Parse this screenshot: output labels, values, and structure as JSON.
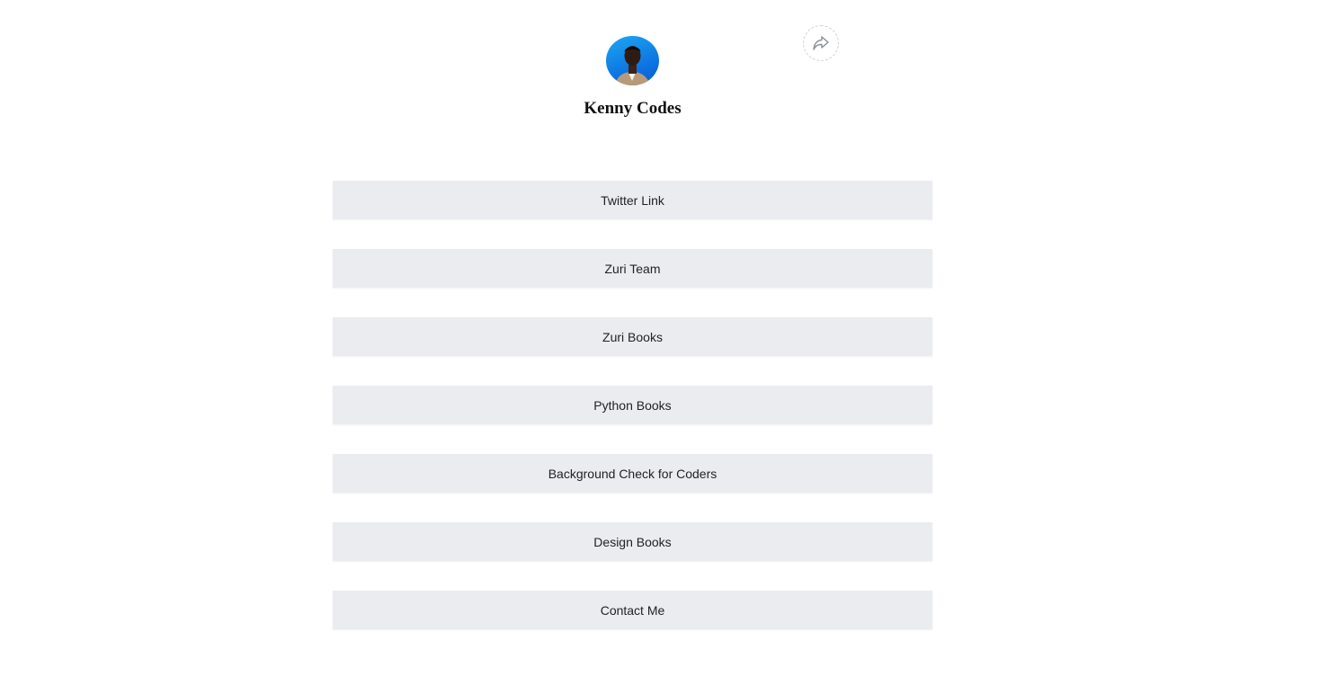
{
  "profile": {
    "name": "Kenny Codes",
    "avatar_icon": "person-avatar",
    "avatar_bg": "#1a8cf0"
  },
  "share": {
    "icon": "share-icon"
  },
  "links": [
    {
      "label": "Twitter Link"
    },
    {
      "label": "Zuri Team"
    },
    {
      "label": "Zuri Books"
    },
    {
      "label": "Python Books"
    },
    {
      "label": "Background Check for Coders"
    },
    {
      "label": "Design Books"
    },
    {
      "label": "Contact Me"
    }
  ],
  "colors": {
    "button_bg": "#ebecf0",
    "text": "#222222",
    "share_border": "#cfd2d8"
  }
}
